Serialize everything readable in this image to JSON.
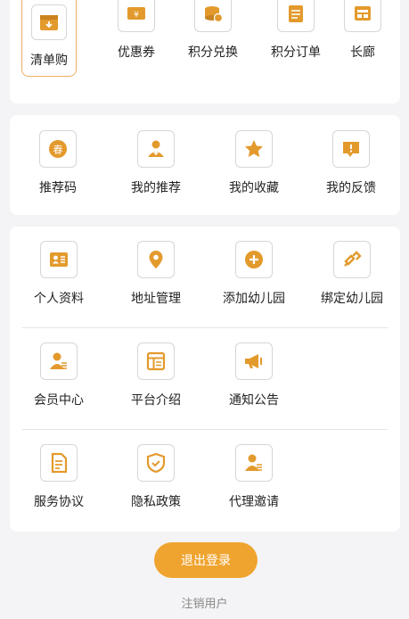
{
  "colors": {
    "accent": "#efa430",
    "icon": "#e39a2c",
    "background": "#f4f4f6",
    "card": "#ffffff"
  },
  "top_row": [
    {
      "label": "清单购",
      "icon": "box-icon",
      "selected": true
    },
    {
      "label": "优惠券",
      "icon": "coupon-icon"
    },
    {
      "label": "积分兑换",
      "icon": "coins-icon"
    },
    {
      "label": "积分订单",
      "icon": "order-icon"
    },
    {
      "label": "长廊",
      "icon": "gallery-icon"
    }
  ],
  "section2": [
    {
      "label": "推荐码",
      "icon": "spring-badge-icon",
      "glyph": "春"
    },
    {
      "label": "我的推荐",
      "icon": "user-plus-icon"
    },
    {
      "label": "我的收藏",
      "icon": "star-icon"
    },
    {
      "label": "我的反馈",
      "icon": "feedback-icon"
    }
  ],
  "section3": {
    "row1": [
      {
        "label": "个人资料",
        "icon": "profile-card-icon"
      },
      {
        "label": "地址管理",
        "icon": "location-pin-icon"
      },
      {
        "label": "添加幼儿园",
        "icon": "plus-circle-icon"
      },
      {
        "label": "绑定幼儿园",
        "icon": "link-icon"
      }
    ],
    "row2": [
      {
        "label": "会员中心",
        "icon": "member-icon"
      },
      {
        "label": "平台介绍",
        "icon": "platform-icon"
      },
      {
        "label": "通知公告",
        "icon": "megaphone-icon"
      }
    ],
    "row3": [
      {
        "label": "服务协议",
        "icon": "document-icon"
      },
      {
        "label": "隐私政策",
        "icon": "shield-check-icon"
      },
      {
        "label": "代理邀请",
        "icon": "agent-icon"
      }
    ]
  },
  "logout_label": "退出登录",
  "cancel_account_label": "注销用户"
}
